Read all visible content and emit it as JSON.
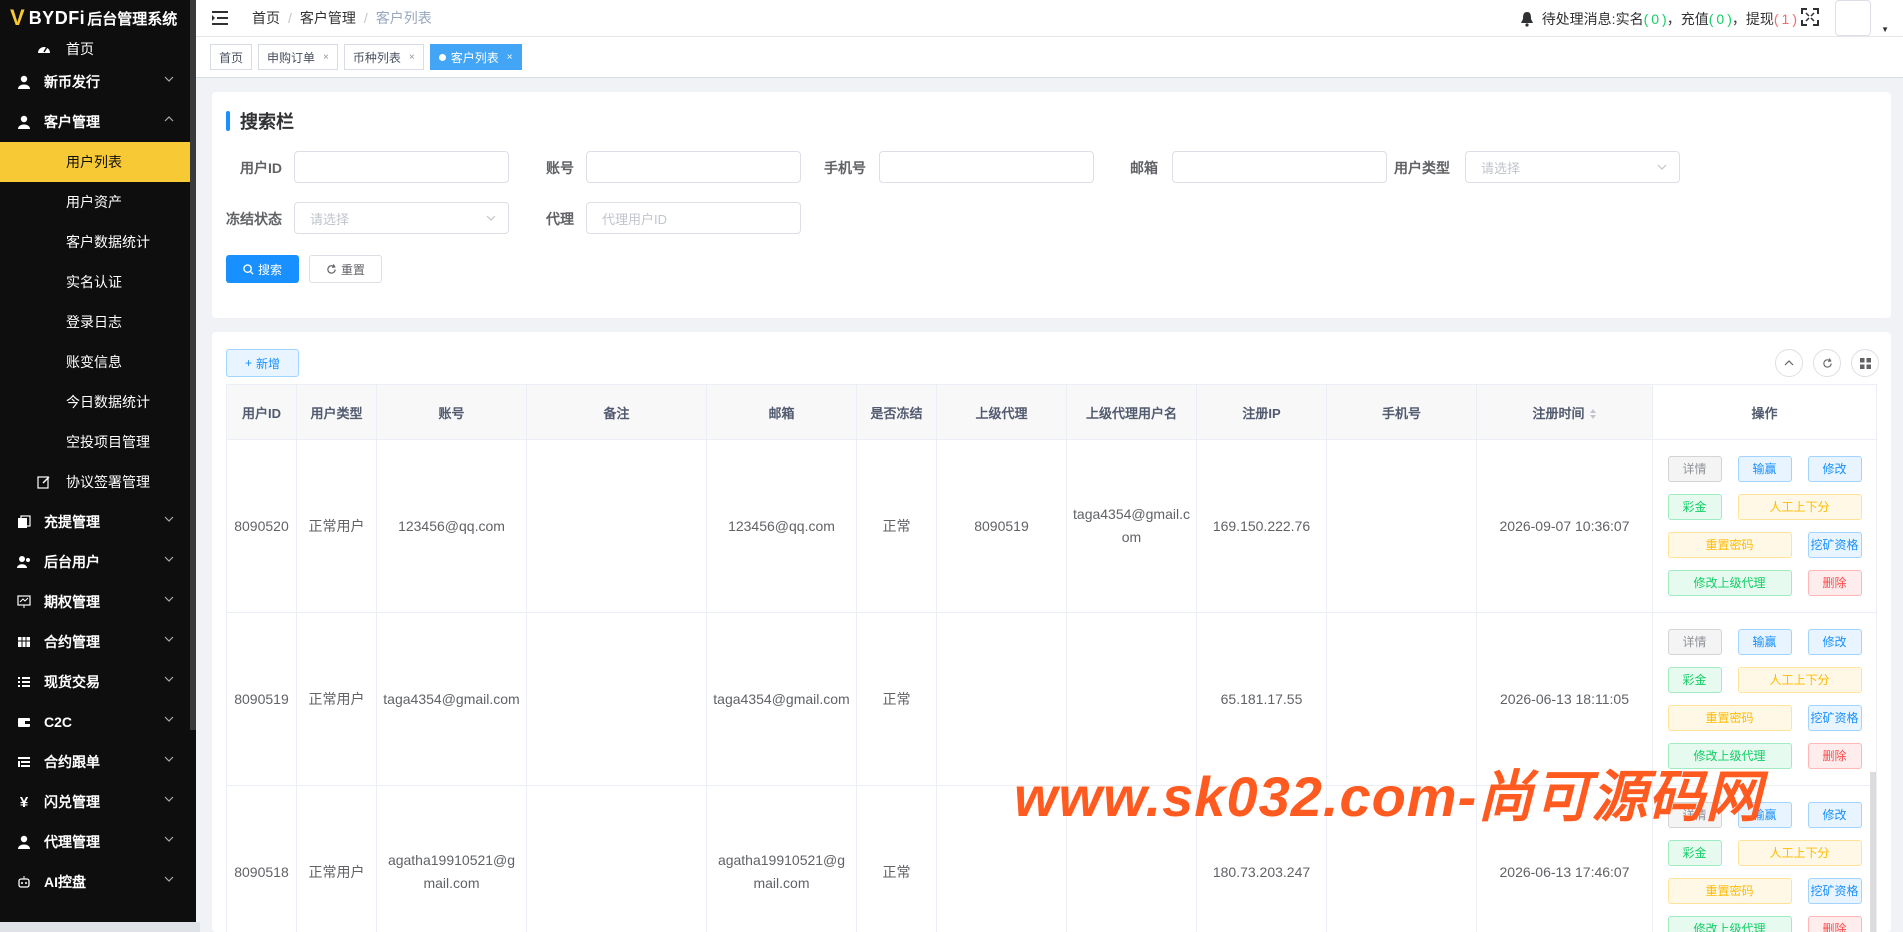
{
  "app": {
    "logo_mark": "V",
    "brand": "BYDFi",
    "system_name": "后台管理系统"
  },
  "sidebar": {
    "home": "首页",
    "groups": [
      {
        "label": "新币发行"
      },
      {
        "label": "客户管理"
      }
    ],
    "customer_sub": [
      "用户列表",
      "用户资产",
      "客户数据统计",
      "实名认证",
      "登录日志",
      "账变信息",
      "今日数据统计",
      "空投项目管理"
    ],
    "agreement": "协议签署管理",
    "more_groups": [
      "充提管理",
      "后台用户",
      "期权管理",
      "合约管理",
      "现货交易",
      "C2C",
      "合约跟单",
      "闪兑管理",
      "代理管理",
      "AI控盘"
    ]
  },
  "header": {
    "breadcrumb": [
      "首页",
      "客户管理",
      "客户列表"
    ],
    "notice_label": "待处理消息:",
    "notice_items": [
      {
        "label": "实名",
        "open": "(",
        "count": "0",
        "close": ")"
      },
      {
        "label": "充值",
        "open": "(",
        "count": "0",
        "close": ")"
      },
      {
        "label": "提现",
        "open": "(",
        "count": "1",
        "close": ")"
      }
    ]
  },
  "tags": [
    {
      "label": "首页"
    },
    {
      "label": "申购订单"
    },
    {
      "label": "币种列表"
    },
    {
      "label": "客户列表",
      "active": true
    }
  ],
  "search": {
    "title": "搜索栏",
    "labels": {
      "user_id": "用户ID",
      "account": "账号",
      "phone": "手机号",
      "email": "邮箱",
      "user_type": "用户类型",
      "freeze": "冻结状态",
      "agent": "代理"
    },
    "placeholders": {
      "select": "请选择",
      "agent": "代理用户ID"
    },
    "search_btn": "搜索",
    "reset_btn": "重置"
  },
  "table": {
    "add_btn": "新增",
    "columns": [
      "用户ID",
      "用户类型",
      "账号",
      "备注",
      "邮箱",
      "是否冻结",
      "上级代理",
      "上级代理用户名",
      "注册IP",
      "手机号",
      "注册时间",
      "操作"
    ],
    "rows": [
      {
        "id": "8090520",
        "type": "正常用户",
        "account": "123456@qq.com",
        "remark": "",
        "email": "123456@qq.com",
        "frozen": "正常",
        "parent": "8090519",
        "parent_name": "taga4354@gmail.com",
        "ip": "169.150.222.76",
        "phone": "",
        "time": "2026-09-07 10:36:07"
      },
      {
        "id": "8090519",
        "type": "正常用户",
        "account": "taga4354@gmail.com",
        "remark": "",
        "email": "taga4354@gmail.com",
        "frozen": "正常",
        "parent": "",
        "parent_name": "",
        "ip": "65.181.17.55",
        "phone": "",
        "time": "2026-06-13 18:11:05"
      },
      {
        "id": "8090518",
        "type": "正常用户",
        "account": "agatha19910521@gmail.com",
        "remark": "",
        "email": "agatha19910521@gmail.com",
        "frozen": "正常",
        "parent": "",
        "parent_name": "",
        "ip": "180.73.203.247",
        "phone": "",
        "time": "2026-06-13 17:46:07"
      }
    ],
    "ops": {
      "detail": "详情",
      "win_lose": "输赢",
      "edit": "修改",
      "bonus": "彩金",
      "manual": "人工上下分",
      "reset_pwd": "重置密码",
      "mining": "挖矿资格",
      "change_parent": "修改上级代理",
      "delete": "删除"
    }
  },
  "watermark": "www.sk032.com-尚可源码网",
  "colors": {
    "accent": "#1890ff",
    "menu_active": "#f6c935",
    "sidebar_bg": "#0e0e0e",
    "watermark": "#ff5a1f"
  }
}
